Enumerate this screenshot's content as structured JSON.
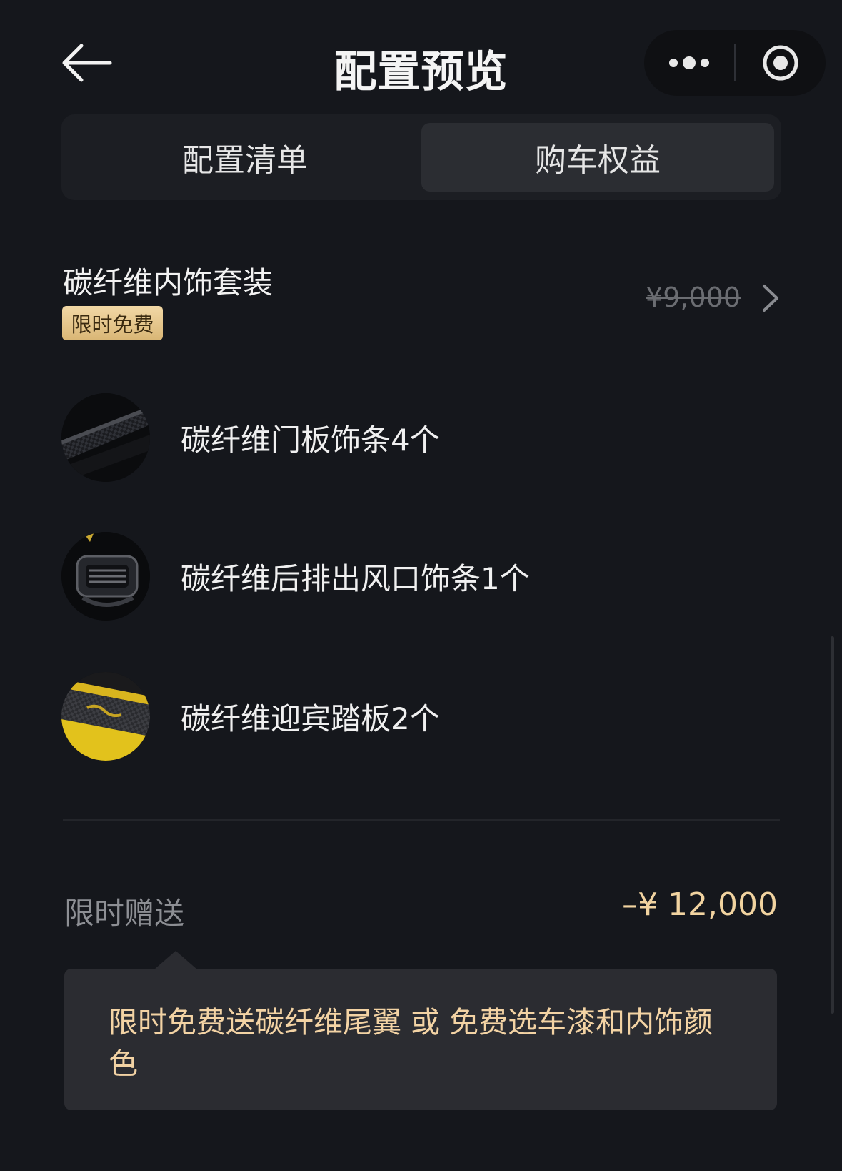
{
  "header": {
    "title": "配置预览",
    "back_icon": "arrow-left-icon",
    "more_icon": "more-dots-icon",
    "close_icon": "target-circle-icon"
  },
  "tabs": [
    {
      "label": "配置清单",
      "selected": false
    },
    {
      "label": "购车权益",
      "selected": true
    }
  ],
  "package": {
    "title": "碳纤维内饰套装",
    "badge": "限时免费",
    "original_price": "¥9,000",
    "items": [
      {
        "label": "碳纤维门板饰条4个"
      },
      {
        "label": "碳纤维后排出风口饰条1个"
      },
      {
        "label": "碳纤维迎宾踏板2个"
      }
    ]
  },
  "gift": {
    "label": "限时赠送",
    "value": "–¥ 12,000",
    "tip": "限时免费送碳纤维尾翼 或 免费选车漆和内饰颜色"
  },
  "colors": {
    "background": "#15171c",
    "accent_gold": "#f1d3a0",
    "badge_gold": "#e6c68b"
  }
}
